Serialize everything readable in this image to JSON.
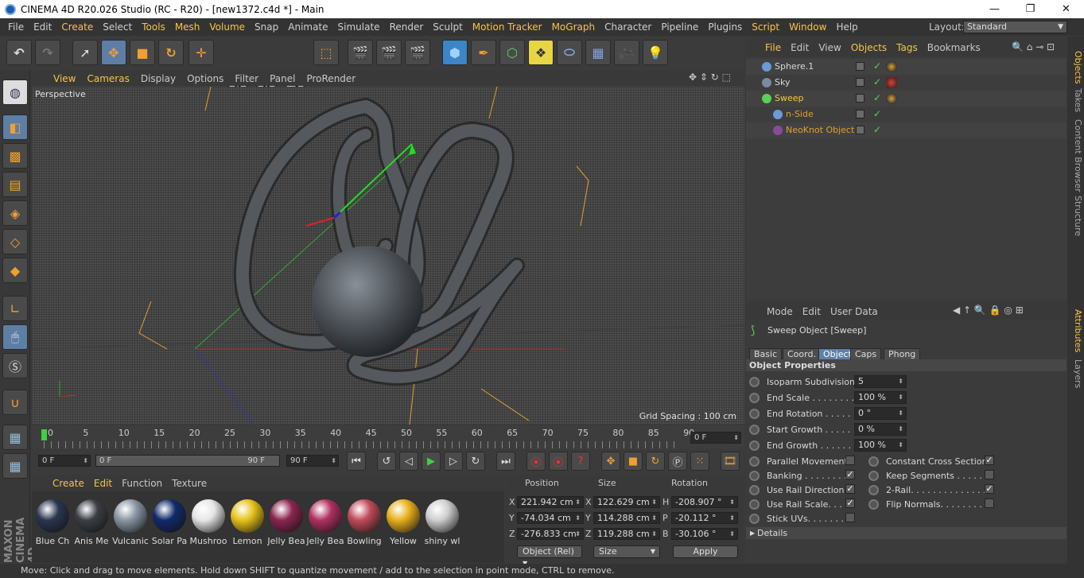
{
  "window": {
    "title": "CINEMA 4D R20.026 Studio (RC - R20) - [new1372.c4d *] - Main",
    "minimize": "—",
    "maximize": "❐",
    "close": "✕"
  },
  "menubar": {
    "items": [
      "File",
      "Edit",
      "Create",
      "Select",
      "Tools",
      "Mesh",
      "Volume",
      "Snap",
      "Animate",
      "Simulate",
      "Render",
      "Sculpt",
      "Motion Tracker",
      "MoGraph",
      "Character",
      "Pipeline",
      "Plugins",
      "Script",
      "Window",
      "Help"
    ],
    "highlighted": [
      "Create",
      "Tools",
      "Mesh",
      "Volume",
      "Motion Tracker",
      "MoGraph",
      "Script",
      "Window"
    ],
    "layout_label": "Layout:",
    "layout_value": "Standard"
  },
  "toolbar": {
    "x_label": "X",
    "y_label": "Y",
    "z_label": "Z"
  },
  "viewport": {
    "menu": [
      "View",
      "Cameras",
      "Display",
      "Options",
      "Filter",
      "Panel",
      "ProRender"
    ],
    "highlighted": [
      "View",
      "Cameras"
    ],
    "label": "Perspective",
    "grid_spacing": "Grid Spacing : 100 cm"
  },
  "timeline": {
    "ticks": [
      "0",
      "5",
      "10",
      "15",
      "20",
      "25",
      "30",
      "35",
      "40",
      "45",
      "50",
      "55",
      "60",
      "65",
      "70",
      "75",
      "80",
      "85",
      "90"
    ],
    "current_frame": "0 F",
    "start_frame": "0 F",
    "range_start": "0 F",
    "range_end": "90 F",
    "end_frame": "90 F"
  },
  "materials": {
    "menu": [
      "Create",
      "Edit",
      "Function",
      "Texture"
    ],
    "highlighted": [
      "Create",
      "Edit"
    ],
    "items": [
      {
        "name": "Blue Ch",
        "color": "#2a3550"
      },
      {
        "name": "Anis Me",
        "color": "#3a3f45"
      },
      {
        "name": "Vulcanic",
        "color": "#8a96a4"
      },
      {
        "name": "Solar Pa",
        "color": "#122a6a"
      },
      {
        "name": "Mushroo",
        "color": "#e6e6e6"
      },
      {
        "name": "Lemon",
        "color": "#e6c21a"
      },
      {
        "name": "Jelly Bea",
        "color": "#8a2550"
      },
      {
        "name": "Jelly Bea",
        "color": "#b03060"
      },
      {
        "name": "Bowling",
        "color": "#c04a5a"
      },
      {
        "name": "Yellow",
        "color": "#e8b01a"
      },
      {
        "name": "shiny wl",
        "color": "#cfcfcf"
      }
    ]
  },
  "coords": {
    "headers": [
      "Position",
      "Size",
      "Rotation"
    ],
    "axes": [
      "X",
      "Y",
      "Z"
    ],
    "size_axes": [
      "X",
      "Y",
      "Z"
    ],
    "rot_axes": [
      "H",
      "P",
      "B"
    ],
    "position": [
      "221.942 cm",
      "-74.034 cm",
      "-276.833 cm"
    ],
    "size": [
      "122.629 cm",
      "114.288 cm",
      "119.288 cm"
    ],
    "rotation": [
      "-208.907 °",
      "-20.112 °",
      "-30.106 °"
    ],
    "mode": "Object (Rel)",
    "size_mode": "Size",
    "apply": "Apply"
  },
  "objects": {
    "menu": [
      "File",
      "Edit",
      "View",
      "Objects",
      "Tags",
      "Bookmarks"
    ],
    "highlighted": [
      "File",
      "Objects",
      "Tags"
    ],
    "rows": [
      {
        "name": "Sphere.1",
        "indent": 16,
        "color": "#d8d8d8",
        "icon": "#6a9ad8"
      },
      {
        "name": "Sky",
        "indent": 16,
        "color": "#d8d8d8",
        "icon": "#7a8aa0"
      },
      {
        "name": "Sweep",
        "indent": 16,
        "color": "#f5c54a",
        "icon": "#5ad15a"
      },
      {
        "name": "n-Side",
        "indent": 30,
        "color": "#e0a030",
        "icon": "#6a9ad8"
      },
      {
        "name": "NeoKnot Object",
        "indent": 30,
        "color": "#e0a030",
        "icon": "#8a4a9a"
      }
    ]
  },
  "side_tabs_top": [
    "Objects",
    "Takes",
    "Content Browser",
    "Structure"
  ],
  "side_tabs_bottom": [
    "Attributes",
    "Layers"
  ],
  "attributes": {
    "menu": [
      "Mode",
      "Edit",
      "User Data"
    ],
    "object_title": "Sweep Object [Sweep]",
    "tabs": [
      "Basic",
      "Coord.",
      "Object",
      "Caps",
      "Phong"
    ],
    "active_tab": "Object",
    "section": "Object Properties",
    "props": [
      {
        "label": "Isoparm Subdivision",
        "value": "5"
      },
      {
        "label": "End Scale . . . . . . . . . .",
        "value": "100 %"
      },
      {
        "label": "End Rotation . . . . . . .",
        "value": "0 °"
      },
      {
        "label": "Start Growth . . . . . . .",
        "value": "0 %"
      },
      {
        "label": "End Growth . . . . . . . .",
        "value": "100 %"
      }
    ],
    "checks_left": [
      {
        "label": "Parallel Movement",
        "checked": false
      },
      {
        "label": "Banking . . . . . . . . .",
        "checked": true
      },
      {
        "label": "Use Rail Direction",
        "checked": true
      },
      {
        "label": "Use Rail Scale. . . .",
        "checked": true
      },
      {
        "label": "Stick UVs. . . . . . . .",
        "checked": false
      }
    ],
    "checks_right": [
      {
        "label": "Constant Cross Section",
        "checked": true
      },
      {
        "label": "Keep Segments . . . . . . .",
        "checked": false
      },
      {
        "label": "2-Rail. . . . . . . . . . . . . . .",
        "checked": true
      },
      {
        "label": "Flip Normals. . . . . . . . .",
        "checked": false
      }
    ],
    "details": "Details",
    "check_mark": "✓"
  },
  "status": "Move: Click and drag to move elements. Hold down SHIFT to quantize movement / add to the selection in point mode, CTRL to remove."
}
